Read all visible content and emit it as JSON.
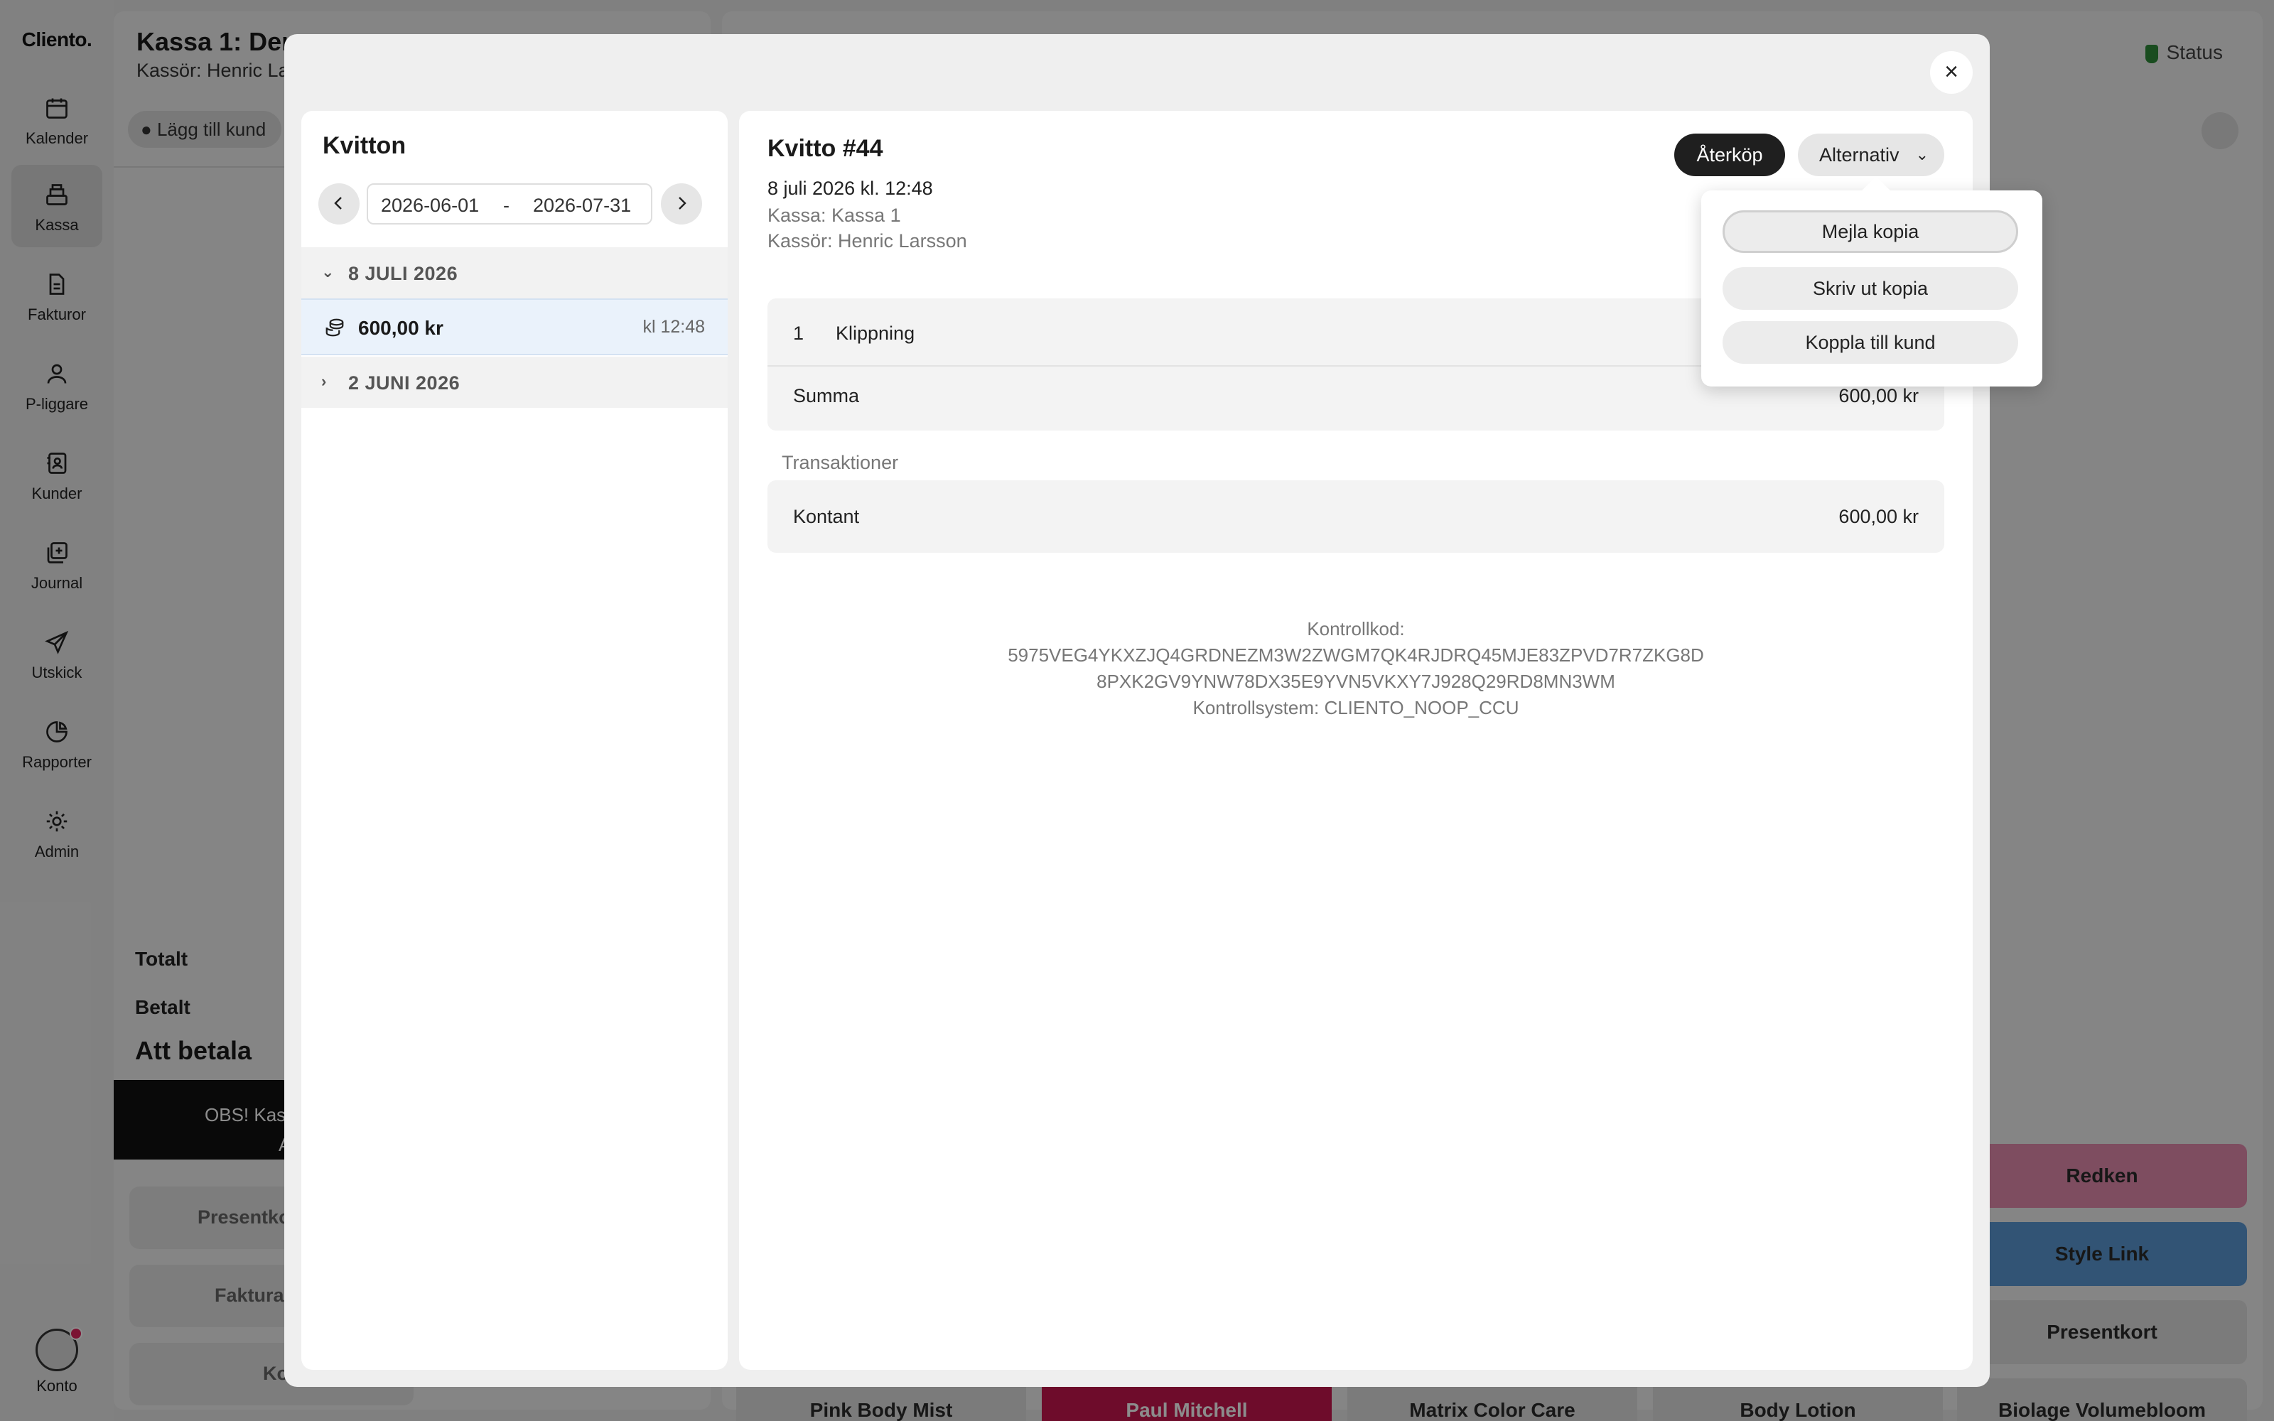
{
  "sidebar": {
    "logo": "Cliento.",
    "items": [
      {
        "label": "Kalender",
        "icon": "calendar-icon"
      },
      {
        "label": "Kassa",
        "icon": "cash-register-icon",
        "active": true
      },
      {
        "label": "Fakturor",
        "icon": "document-icon"
      },
      {
        "label": "P-liggare",
        "icon": "person-icon"
      },
      {
        "label": "Kunder",
        "icon": "contact-book-icon"
      },
      {
        "label": "Journal",
        "icon": "journal-icon"
      },
      {
        "label": "Utskick",
        "icon": "paper-plane-icon"
      },
      {
        "label": "Rapporter",
        "icon": "pie-chart-icon"
      },
      {
        "label": "Admin",
        "icon": "gear-icon"
      }
    ],
    "account_label": "Konto"
  },
  "background": {
    "title": "Kassa 1: Dem",
    "subtitle": "Kassör: Henric La",
    "add_customer": "Lägg till kund",
    "totalt": "Totalt",
    "betalt": "Betalt",
    "att_betala": "Att betala",
    "notice_line1": "OBS! Kas",
    "notice_line2": "A",
    "btn_presentkort": "Presentkort",
    "btn_faktura": "Faktura",
    "btn_kontant": "Kon",
    "status": "Status",
    "tiles": {
      "redken": "Redken",
      "style_link": "Style Link",
      "presentkort": "Presentkort",
      "pink_body_mist": "Pink Body Mist",
      "paul_mitchell": "Paul Mitchell",
      "matrix_color_care": "Matrix Color Care",
      "body_lotion": "Body Lotion",
      "biolage_volumebloom": "Biolage Volumebloom"
    },
    "colors": {
      "redken": "#e58db0",
      "style_link": "#5b9ad6",
      "paul_mitchell": "#c8174f"
    }
  },
  "receipts": {
    "title": "Kvitton",
    "date_from": "2026-06-01",
    "date_separator": "-",
    "date_to": "2026-07-31",
    "groups": [
      {
        "label": "8 JULI 2026",
        "expanded": true,
        "items": [
          {
            "amount": "600,00 kr",
            "time": "kl 12:48"
          }
        ]
      },
      {
        "label": "2 JUNI 2026",
        "expanded": false,
        "items": []
      }
    ]
  },
  "receipt_detail": {
    "title": "Kvitto #44",
    "datetime": "8 juli 2026 kl. 12:48",
    "kassa": "Kassa: Kassa 1",
    "kassor": "Kassör: Henric Larsson",
    "refund_button": "Återköp",
    "options_button": "Alternativ",
    "line_items": [
      {
        "qty": "1",
        "name": "Klippning"
      }
    ],
    "summa_label": "Summa",
    "summa_value": "600,00 kr",
    "transactions_label": "Transaktioner",
    "transactions": [
      {
        "method": "Kontant",
        "amount": "600,00 kr"
      }
    ],
    "control_code_label": "Kontrollkod:",
    "control_code_line1": "5975VEG4YKXZJQ4GRDNEZM3W2ZWGM7QK4RJDRQ45MJE83ZPVD7R7ZKG8D",
    "control_code_line2": "8PXK2GV9YNW78DX35E9YVN5VKXY7J928Q29RD8MN3WM",
    "control_system": "Kontrollsystem: CLIENTO_NOOP_CCU"
  },
  "options_menu": {
    "items": [
      "Mejla kopia",
      "Skriv ut kopia",
      "Koppla till kund"
    ]
  }
}
